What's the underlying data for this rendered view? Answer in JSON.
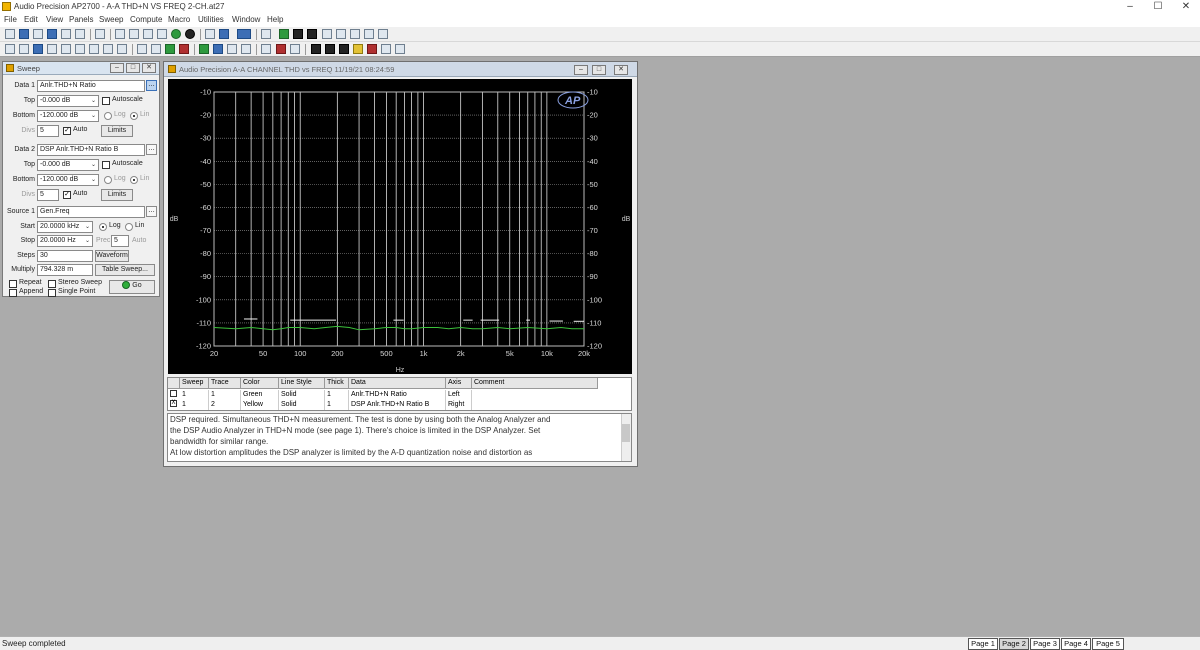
{
  "window": {
    "title": "Audio Precision AP2700 - A-A THD+N VS FREQ 2-CH.at27",
    "minimize": "–",
    "maximize": "☐"
  },
  "menu": [
    "File",
    "Edit",
    "View",
    "Panels",
    "Sweep",
    "Compute",
    "Macro",
    "Utilities",
    "Window",
    "Help"
  ],
  "sweep_panel": {
    "title": "Sweep",
    "data1_label": "Data 1",
    "data1_value": "Anlr.THD+N Ratio",
    "top_label": "Top",
    "top1": "-0.000 dB",
    "bottom_label": "Bottom",
    "bottom1": "-120.000 dB",
    "autoscale": "Autoscale",
    "log": "Log",
    "lin": "Lin",
    "divs_label": "Divs",
    "divs1": "5",
    "auto": "Auto",
    "limits": "Limits",
    "data2_label": "Data 2",
    "data2_value": "DSP Anlr.THD+N Ratio B",
    "top2": "-0.000 dB",
    "bottom2": "-120.000 dB",
    "divs2": "5",
    "source1_label": "Source 1",
    "source1_value": "Gen.Freq",
    "start_label": "Start",
    "start_value": "20.0000 kHz",
    "stop_label": "Stop",
    "stop_value": "20.0000 Hz",
    "prec_label": "Prec",
    "prec_value": "5",
    "steps_label": "Steps",
    "steps_value": "30",
    "waveform": "Waveform",
    "multiply_label": "Multiply",
    "multiply_value": "794.328 m",
    "table_sweep": "Table Sweep...",
    "repeat": "Repeat",
    "stereo_sweep": "Stereo Sweep",
    "append": "Append",
    "single_point": "Single Point",
    "go": "Go"
  },
  "graph_window": {
    "title": "Audio Precision   A-A CHANNEL THD vs FREQ     11/19/21 08:24:59",
    "logo": "AP"
  },
  "chart_data": {
    "type": "line",
    "xlabel": "Hz",
    "ylabel_left": "dB",
    "ylabel_right": "dB",
    "x_scale": "log",
    "xlim": [
      20,
      20000
    ],
    "ylim": [
      -120,
      -10
    ],
    "xticks": [
      "20",
      "50",
      "100",
      "200",
      "500",
      "1k",
      "2k",
      "5k",
      "10k",
      "20k"
    ],
    "yticks": [
      "-10",
      "-20",
      "-30",
      "-40",
      "-50",
      "-60",
      "-70",
      "-80",
      "-90",
      "-100",
      "-110",
      "-120"
    ],
    "grid": true,
    "series": [
      {
        "name": "Anlr.THD+N Ratio",
        "color": "#3cc23c",
        "x": [
          20,
          30,
          40,
          50,
          60,
          70,
          80,
          100,
          130,
          160,
          200,
          250,
          300,
          400,
          500,
          600,
          700,
          800,
          1000,
          1300,
          1600,
          2000,
          2500,
          3000,
          4000,
          5000,
          7000,
          10000,
          13000,
          16000,
          20000
        ],
        "y": [
          -112,
          -112.5,
          -112,
          -112.5,
          -113,
          -112.5,
          -112,
          -112,
          -112.5,
          -112,
          -111.5,
          -112,
          -113,
          -112.5,
          -112,
          -112,
          -112.5,
          -112.5,
          -112,
          -112,
          -112.5,
          -112,
          -112.5,
          -112.5,
          -112,
          -112.5,
          -112,
          -112.5,
          -112,
          -112.5,
          -112.5
        ]
      },
      {
        "name": "DSP Anlr.THD+N Ratio B",
        "color": "#f2f2f2",
        "segments": [
          {
            "x": [
              35,
              45
            ],
            "y": -108.3
          },
          {
            "x": [
              83,
              195
            ],
            "y": -108.8
          },
          {
            "x": [
              570,
              690
            ],
            "y": -108.8
          },
          {
            "x": [
              2100,
              2500
            ],
            "y": -108.8
          },
          {
            "x": [
              2900,
              4100
            ],
            "y": -108.8
          },
          {
            "x": [
              6800,
              7300
            ],
            "y": -108.8
          },
          {
            "x": [
              10500,
              13500
            ],
            "y": -109.2
          },
          {
            "x": [
              16500,
              21000
            ],
            "y": -109.3
          }
        ]
      }
    ]
  },
  "trace_table": {
    "headers": [
      "Sweep",
      "Trace",
      "Color",
      "Line Style",
      "Thick",
      "Data",
      "Axis",
      "Comment"
    ],
    "rows": [
      {
        "check": "",
        "sweep": "1",
        "trace": "1",
        "color": "Green",
        "style": "Solid",
        "thick": "1",
        "data": "Anlr.THD+N Ratio",
        "axis": "Left"
      },
      {
        "check": "X",
        "sweep": "1",
        "trace": "2",
        "color": "Yellow",
        "style": "Solid",
        "thick": "1",
        "data": "DSP Anlr.THD+N Ratio B",
        "axis": "Right"
      }
    ]
  },
  "comment_lines": [
    "DSP required. Simultaneous THD+N measurement. The test is done by using both the Analog Analyzer and",
    "the DSP Audio Analyzer in THD+N mode (see page 1). There's choice is limited in the DSP Analyzer. Set",
    "bandwidth for similar range.",
    "At low distortion amplitudes the DSP analyzer is limited by the A-D quantization noise and distortion as"
  ],
  "status": {
    "text": "Sweep completed",
    "pages": [
      "Page 1",
      "Page 2",
      "Page 3",
      "Page 4",
      "Page 5"
    ],
    "active_page": 1
  }
}
